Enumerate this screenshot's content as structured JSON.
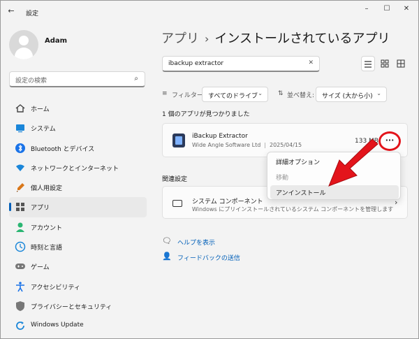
{
  "window": {
    "title": "設定",
    "back_glyph": "←",
    "controls": {
      "minimize": "–",
      "maximize": "☐",
      "close": "✕"
    }
  },
  "user": {
    "name": "Adam"
  },
  "sidebar": {
    "search_placeholder": "設定の検索",
    "search_icon": "⌕",
    "items": [
      {
        "label": "ホーム",
        "icon": "home-icon",
        "color": "#444444",
        "active": false
      },
      {
        "label": "システム",
        "icon": "system-icon",
        "color": "#1a86d9",
        "active": false
      },
      {
        "label": "Bluetooth とデバイス",
        "icon": "bluetooth-icon",
        "color": "#1a73e8",
        "active": false
      },
      {
        "label": "ネットワークとインターネット",
        "icon": "network-icon",
        "color": "#1a86d9",
        "active": false
      },
      {
        "label": "個人用設定",
        "icon": "personalization-icon",
        "color": "#d9771a",
        "active": false
      },
      {
        "label": "アプリ",
        "icon": "apps-icon",
        "color": "#555555",
        "active": true
      },
      {
        "label": "アカウント",
        "icon": "account-icon",
        "color": "#2bb673",
        "active": false
      },
      {
        "label": "時刻と言語",
        "icon": "time-language-icon",
        "color": "#1a86d9",
        "active": false
      },
      {
        "label": "ゲーム",
        "icon": "gaming-icon",
        "color": "#777777",
        "active": false
      },
      {
        "label": "アクセシビリティ",
        "icon": "accessibility-icon",
        "color": "#1a73e8",
        "active": false
      },
      {
        "label": "プライバシーとセキュリティ",
        "icon": "privacy-icon",
        "color": "#777777",
        "active": false
      },
      {
        "label": "Windows Update",
        "icon": "windows-update-icon",
        "color": "#1a86d9",
        "active": false
      }
    ]
  },
  "main": {
    "breadcrumb": {
      "parent": "アプリ",
      "separator": "›",
      "current": "インストールされているアプリ"
    },
    "search": {
      "value": "ibackup extractor",
      "clear_glyph": "✕"
    },
    "view_buttons": [
      "list-view-icon",
      "grid-view-icon",
      "tile-view-icon"
    ],
    "filter": {
      "filter_icon": "≡",
      "filter_label": "フィルター:",
      "filter_value": "すべてのドライブ",
      "sort_icon": "⇅",
      "sort_label": "並べ替え:",
      "sort_value": "サイズ (大から小)",
      "chevron": "⌄"
    },
    "found_text": "1 個のアプリが見つかりました",
    "app": {
      "name": "iBackup Extractor",
      "publisher": "Wide Angle Software Ltd",
      "separator": "|",
      "date": "2025/04/15",
      "size": "133 MB",
      "more_glyph": "···"
    },
    "context_menu": [
      {
        "label": "詳細オプション",
        "disabled": false,
        "hover": false
      },
      {
        "label": "移動",
        "disabled": true,
        "hover": false
      },
      {
        "label": "アンインストール",
        "disabled": false,
        "hover": true
      }
    ],
    "related_label": "関連設定",
    "system_components": {
      "title": "システム コンポーネント",
      "subtitle": "Windows にプリインストールされているシステム コンポーネントを管理します",
      "chevron": "›"
    },
    "links": [
      {
        "label": "ヘルプを表示",
        "icon": "help-icon",
        "glyph": "🗨"
      },
      {
        "label": "フィードバックの送信",
        "icon": "feedback-icon",
        "glyph": "👤"
      }
    ],
    "annotation_color": "#e3141b"
  }
}
